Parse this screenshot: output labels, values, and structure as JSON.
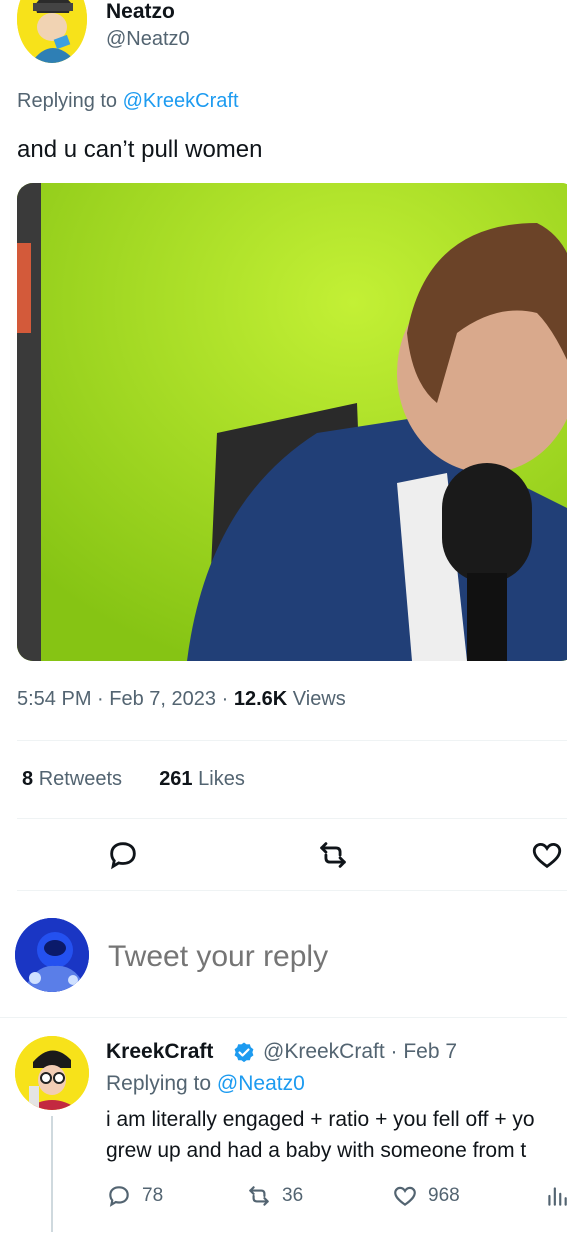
{
  "tweet": {
    "author": {
      "display_name": "Neatzo",
      "handle": "@Neatz0"
    },
    "replying_prefix": "Replying to",
    "replying_to": "@KreekCraft",
    "text": "and u can’t pull women",
    "time": "5:54 PM",
    "date": "Feb 7, 2023",
    "views_count": "12.6K",
    "views_label": "Views",
    "retweets_count": "8",
    "retweets_label": "Retweets",
    "likes_count": "261",
    "likes_label": "Likes"
  },
  "compose": {
    "placeholder": "Tweet your reply"
  },
  "reply": {
    "display_name": "KreekCraft",
    "handle_date": "@KreekCraft · Feb 7",
    "replying_prefix": "Replying to",
    "replying_to": "@Neatz0",
    "line1": "i am literally engaged + ratio + you fell off + yo",
    "line2": "grew up and had a baby with someone from t",
    "replies": "78",
    "retweets": "36",
    "likes": "968"
  },
  "icons": [
    "reply-icon",
    "retweet-icon",
    "like-icon",
    "views-icon",
    "verified-icon"
  ],
  "colors": {
    "accent": "#1d9bf0",
    "secondary_text": "#536471",
    "green_screen": "#9fd81a"
  }
}
